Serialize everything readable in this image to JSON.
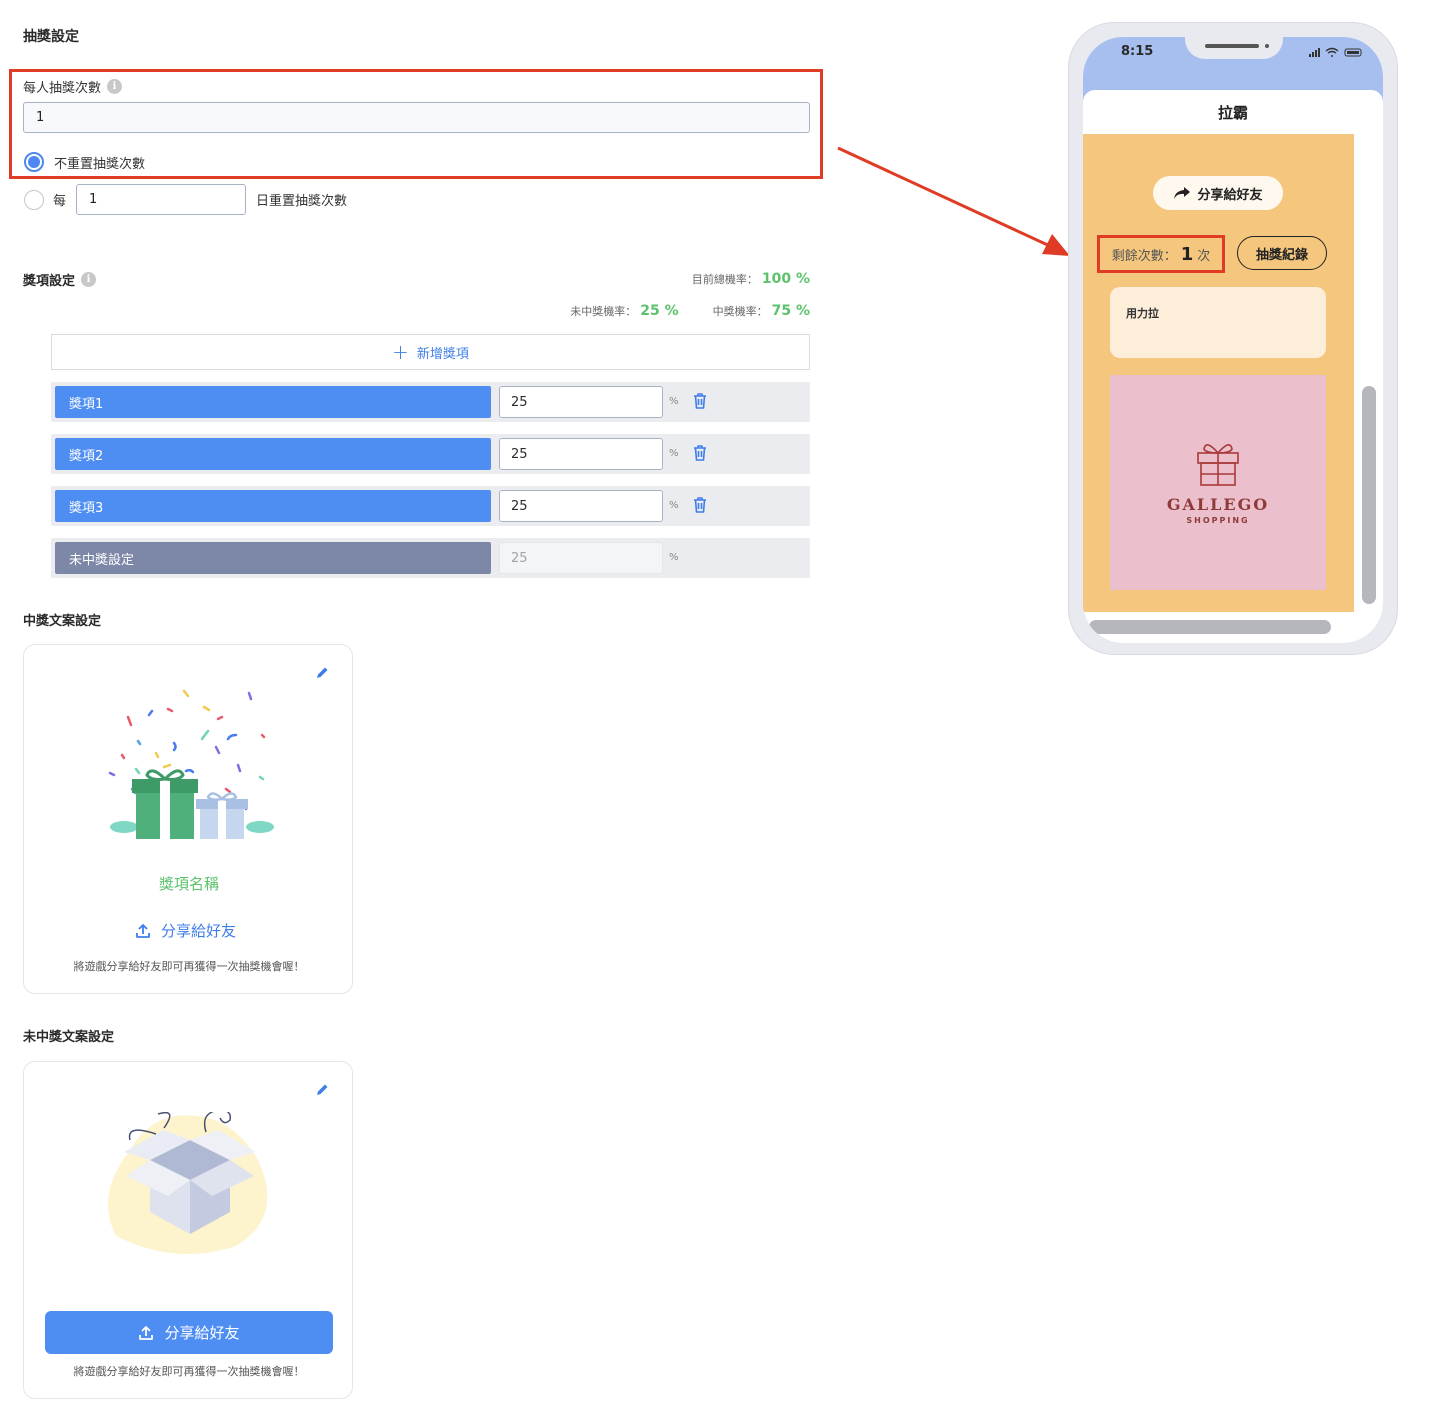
{
  "settings": {
    "title": "抽獎設定",
    "draws_per_person": {
      "label": "每人抽獎次數",
      "info": "i",
      "value": "1"
    },
    "reset_options": {
      "no_reset_label": "不重置抽獎次數",
      "every_prefix": "每",
      "every_value": "1",
      "every_suffix": "日重置抽獎次數"
    }
  },
  "prizes": {
    "title": "獎項設定",
    "info": "i",
    "total_prob_label": "目前總機率：",
    "total_prob_value": "100 %",
    "no_win_label": "未中獎機率：",
    "no_win_value": "25 %",
    "win_label": "中獎機率：",
    "win_value": "75 %",
    "add_button": "新增獎項",
    "percent_sign": "%",
    "items": [
      {
        "name": "獎項1",
        "value": "25"
      },
      {
        "name": "獎項2",
        "value": "25"
      },
      {
        "name": "獎項3",
        "value": "25"
      },
      {
        "name": "未中獎設定",
        "value": "25"
      }
    ]
  },
  "win_copy": {
    "title": "中獎文案設定",
    "prize_name": "獎項名稱",
    "share_label": "分享給好友",
    "note": "將遊戲分享給好友即可再獲得一次抽獎機會喔！"
  },
  "lose_copy": {
    "title": "未中獎文案設定",
    "share_label": "分享給好友",
    "note": "將遊戲分享給好友即可再獲得一次抽獎機會喔！"
  },
  "phone": {
    "time": "8:15",
    "screen_title": "拉霸",
    "share_button": "分享給好友",
    "remaining_label": "剩餘次數：",
    "remaining_value": "1",
    "remaining_unit": "次",
    "records_button": "抽獎紀錄",
    "pull_text": "用力拉",
    "brand_name": "GALLEGO",
    "brand_sub": "SHOPPING"
  },
  "colors": {
    "accent_blue": "#4e8ef3",
    "highlight_red": "#e03b24",
    "probability_green": "#5cc26b",
    "phone_orange": "#f5c77e",
    "brand_pink": "#ebbfcb"
  }
}
